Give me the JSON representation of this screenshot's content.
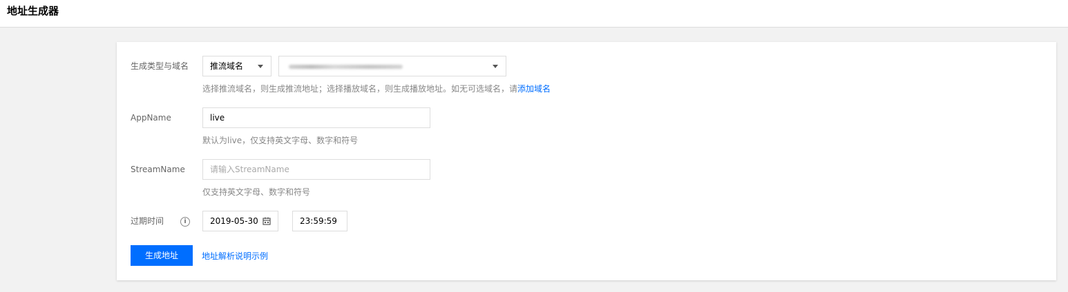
{
  "header": {
    "title": "地址生成器"
  },
  "form": {
    "type_domain": {
      "label": "生成类型与域名",
      "type_value": "推流域名",
      "hint": "选择推流域名，则生成推流地址；选择播放域名，则生成播放地址。如无可选域名，请",
      "hint_link": "添加域名"
    },
    "app_name": {
      "label": "AppName",
      "value": "live",
      "hint": "默认为live，仅支持英文字母、数字和符号"
    },
    "stream_name": {
      "label": "StreamName",
      "placeholder": "请输入StreamName",
      "hint": "仅支持英文字母、数字和符号"
    },
    "expire": {
      "label": "过期时间",
      "date": "2019-05-30",
      "time": "23:59:59"
    }
  },
  "actions": {
    "generate_label": "生成地址",
    "example_link": "地址解析说明示例"
  },
  "colors": {
    "accent": "#006eff",
    "background": "#f2f2f2"
  },
  "icons": [
    "chevron-down-icon",
    "info-icon",
    "calendar-icon"
  ]
}
